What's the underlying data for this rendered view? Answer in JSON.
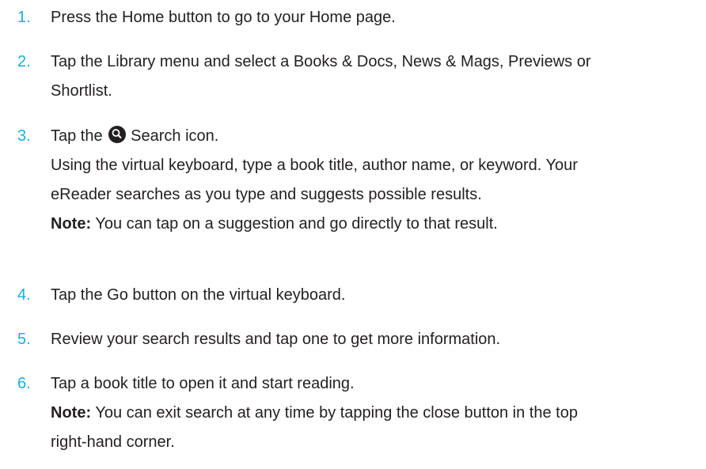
{
  "steps": [
    {
      "number": "1.",
      "lines": [
        "Press the Home button to go to your Home page."
      ]
    },
    {
      "number": "2.",
      "lines": [
        "Tap the Library menu and select a Books & Docs, News & Mags, Previews or",
        "Shortlist."
      ]
    },
    {
      "number": "3.",
      "title_before": "Tap the",
      "title_after": "Search icon.",
      "icon": "search-icon",
      "lines": [
        "Using the virtual keyboard, type a book title, author name, or keyword. Your",
        "eReader searches as you type and suggests possible results."
      ],
      "note_label": "Note:",
      "note_text": "You can tap on a suggestion and go directly to that result."
    },
    {
      "number": "4.",
      "lines": [
        "Tap the Go button on the virtual keyboard."
      ]
    },
    {
      "number": "5.",
      "lines": [
        "Review your search results and tap one to get more information."
      ]
    },
    {
      "number": "6.",
      "lines": [
        "Tap a book title to open it and start reading."
      ],
      "note_label": "Note:",
      "note_lines": [
        "You can exit search at any time by tapping the close button in the top",
        "right-hand corner."
      ]
    }
  ],
  "colors": {
    "number": "#1ab0d8",
    "text": "#231f20"
  }
}
